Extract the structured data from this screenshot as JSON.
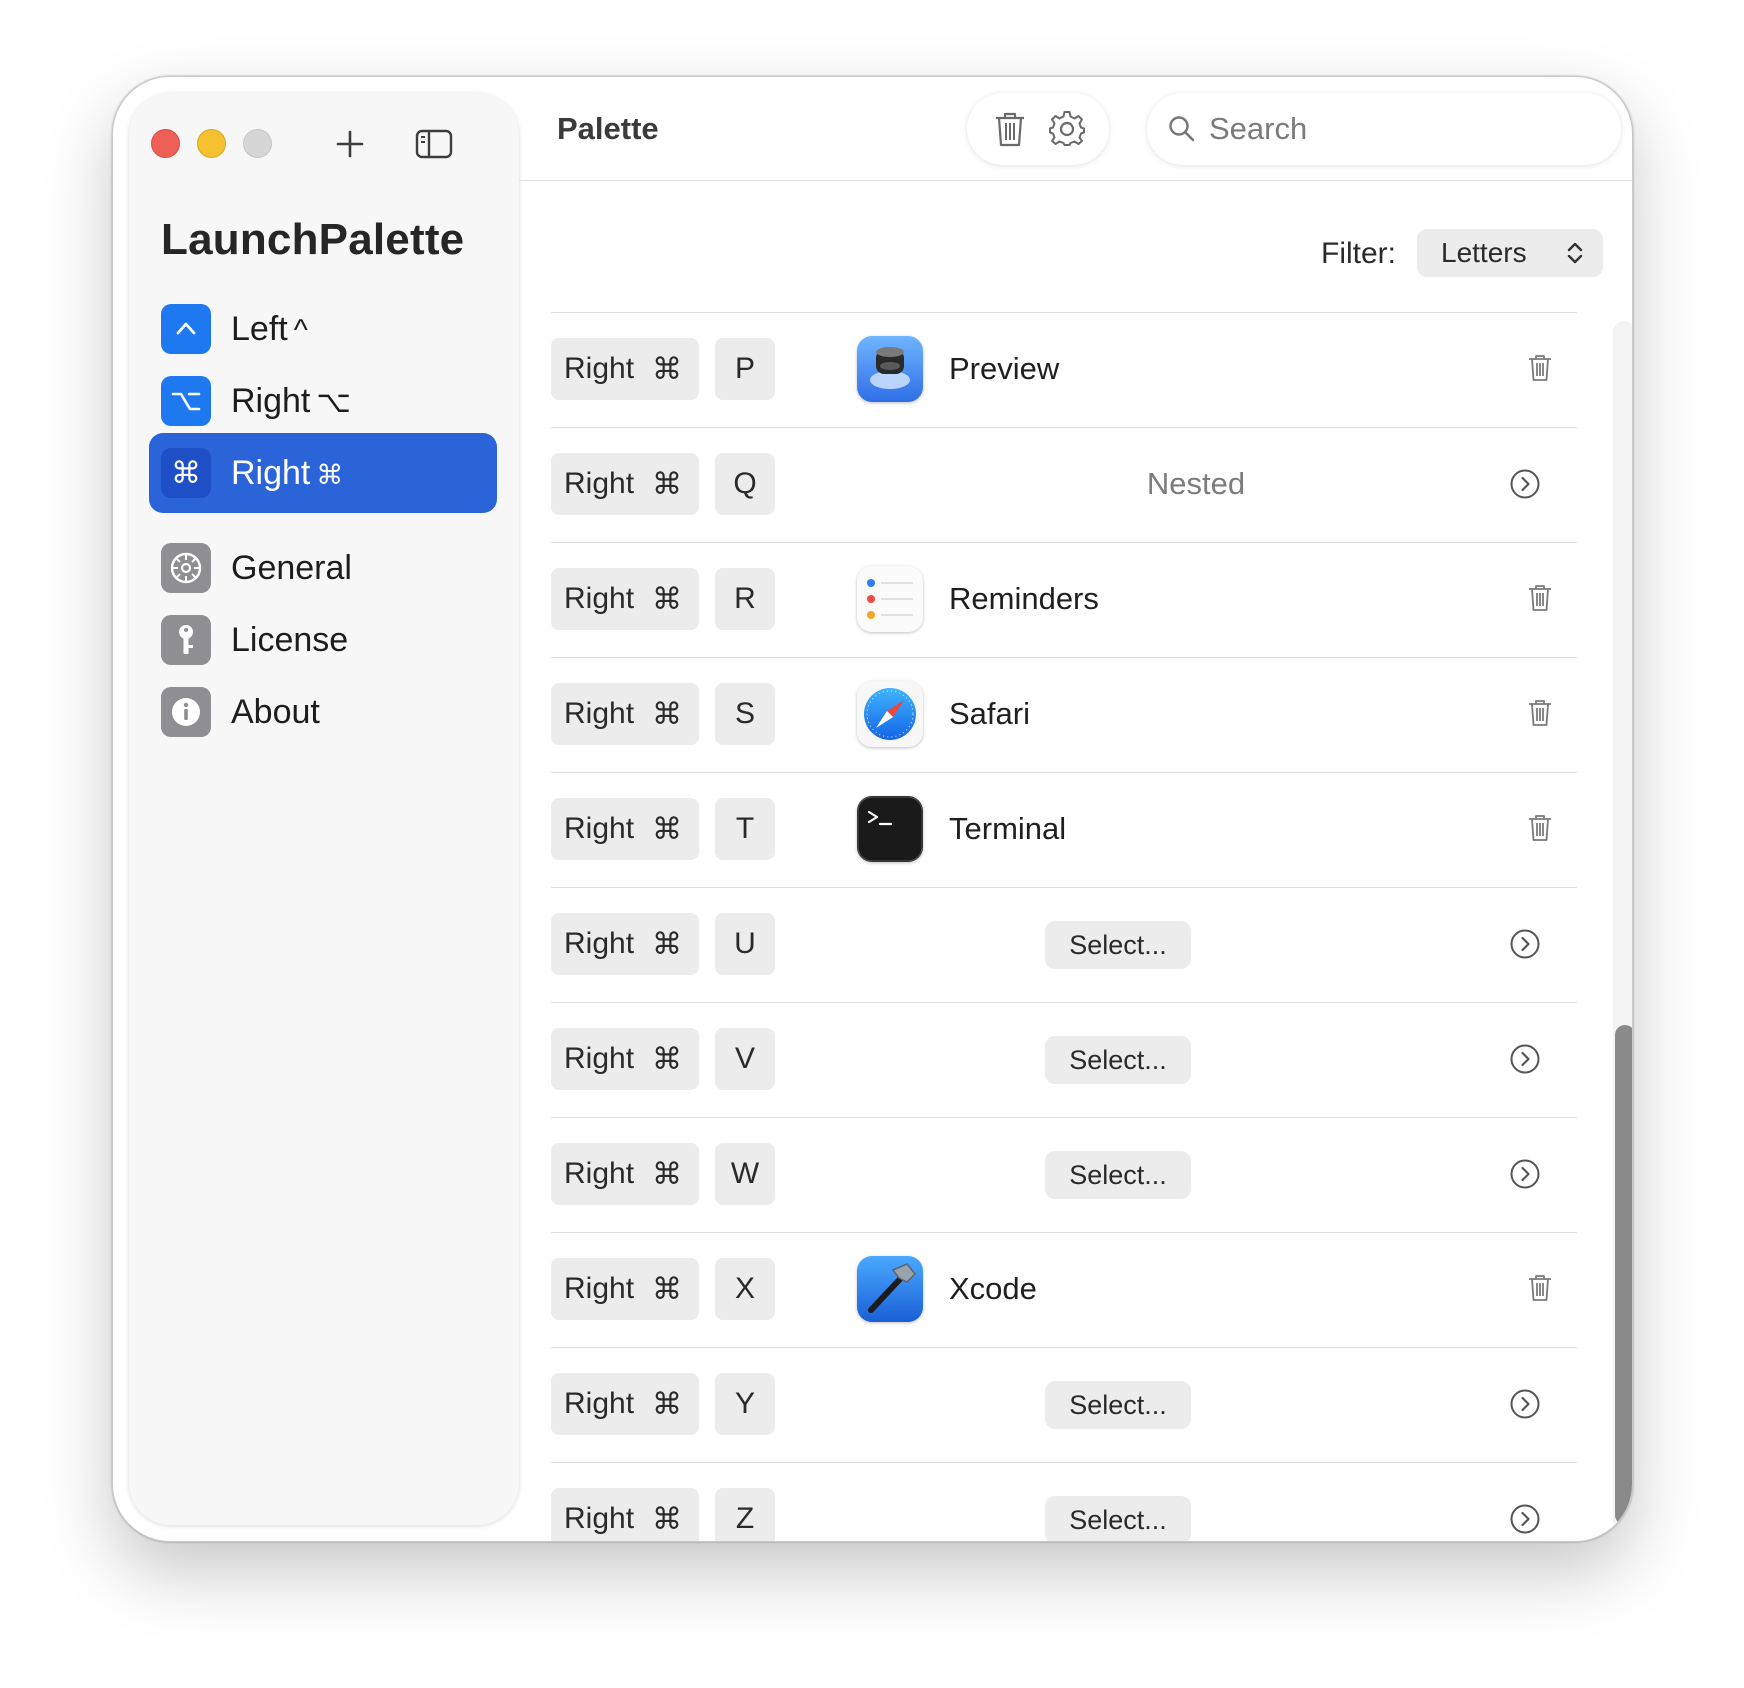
{
  "window": {
    "colors": {
      "accent": "#2b63d9",
      "close": "#ee5f57",
      "minimize": "#f5c12e",
      "zoom": "#d6d6d6"
    }
  },
  "sidebar": {
    "app_title": "LaunchPalette",
    "add_icon": "plus-icon",
    "toggle_icon": "sidebar-toggle-icon",
    "items": [
      {
        "label": "Left",
        "glyph": "^",
        "icon": "control-key-icon",
        "selected": false
      },
      {
        "label": "Right",
        "glyph": "⌥",
        "icon": "option-key-icon",
        "selected": false
      },
      {
        "label": "Right",
        "glyph": "⌘",
        "icon": "command-key-icon",
        "selected": true
      },
      {
        "label": "General",
        "icon": "gear-icon",
        "selected": false
      },
      {
        "label": "License",
        "icon": "key-icon",
        "selected": false
      },
      {
        "label": "About",
        "icon": "info-icon",
        "selected": false
      }
    ]
  },
  "toolbar": {
    "title": "Palette",
    "trash_icon": "trash-icon",
    "settings_icon": "gear-icon",
    "search_placeholder": "Search"
  },
  "filter": {
    "label": "Filter:",
    "selected": "Letters"
  },
  "list": {
    "rows": [
      {
        "modifier": "Right",
        "modifier_glyph": "⌘",
        "key": "P",
        "kind": "app",
        "app": "Preview",
        "icon": "preview-app-icon",
        "action_icon": "trash-icon"
      },
      {
        "modifier": "Right",
        "modifier_glyph": "⌘",
        "key": "Q",
        "kind": "nested",
        "text": "Nested",
        "action_icon": "chevron-right-circle-icon"
      },
      {
        "modifier": "Right",
        "modifier_glyph": "⌘",
        "key": "R",
        "kind": "app",
        "app": "Reminders",
        "icon": "reminders-app-icon",
        "action_icon": "trash-icon"
      },
      {
        "modifier": "Right",
        "modifier_glyph": "⌘",
        "key": "S",
        "kind": "app",
        "app": "Safari",
        "icon": "safari-app-icon",
        "action_icon": "trash-icon"
      },
      {
        "modifier": "Right",
        "modifier_glyph": "⌘",
        "key": "T",
        "kind": "app",
        "app": "Terminal",
        "icon": "terminal-app-icon",
        "action_icon": "trash-icon"
      },
      {
        "modifier": "Right",
        "modifier_glyph": "⌘",
        "key": "U",
        "kind": "select",
        "text": "Select...",
        "action_icon": "chevron-right-circle-icon"
      },
      {
        "modifier": "Right",
        "modifier_glyph": "⌘",
        "key": "V",
        "kind": "select",
        "text": "Select...",
        "action_icon": "chevron-right-circle-icon"
      },
      {
        "modifier": "Right",
        "modifier_glyph": "⌘",
        "key": "W",
        "kind": "select",
        "text": "Select...",
        "action_icon": "chevron-right-circle-icon"
      },
      {
        "modifier": "Right",
        "modifier_glyph": "⌘",
        "key": "X",
        "kind": "app",
        "app": "Xcode",
        "icon": "xcode-app-icon",
        "action_icon": "trash-icon"
      },
      {
        "modifier": "Right",
        "modifier_glyph": "⌘",
        "key": "Y",
        "kind": "select",
        "text": "Select...",
        "action_icon": "chevron-right-circle-icon"
      },
      {
        "modifier": "Right",
        "modifier_glyph": "⌘",
        "key": "Z",
        "kind": "select",
        "text": "Select...",
        "action_icon": "chevron-right-circle-icon"
      }
    ]
  }
}
